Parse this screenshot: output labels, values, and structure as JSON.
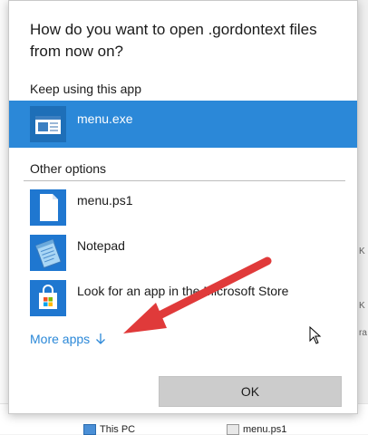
{
  "dialog": {
    "title": "How do you want to open .gordontext files from now on?",
    "keep_label": "Keep using this app",
    "other_label": "Other options",
    "more_apps": "More apps",
    "ok": "OK"
  },
  "apps": {
    "current": {
      "name": "menu.exe",
      "icon": "window-app-icon"
    },
    "ps1": {
      "name": "menu.ps1",
      "icon": "blank-file-icon"
    },
    "notepad": {
      "name": "Notepad",
      "icon": "notepad-icon"
    },
    "store": {
      "name": "Look for an app in the Microsoft Store",
      "icon": "store-bag-icon"
    }
  },
  "background": {
    "this_pc": "This PC",
    "file": "menu.ps1",
    "side_marks": [
      "K",
      "K",
      "ra"
    ]
  },
  "colors": {
    "selection": "#2b88d8",
    "accent_link": "#2b88d8",
    "arrow": "#e03a3a"
  }
}
